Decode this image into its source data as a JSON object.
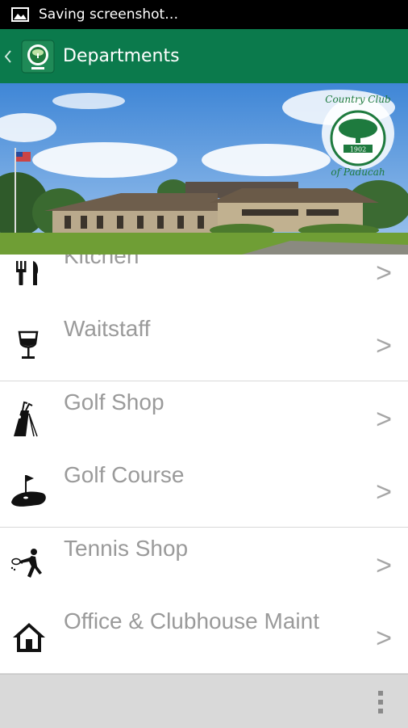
{
  "status_bar": {
    "text": "Saving screenshot…",
    "icon": "image-icon"
  },
  "action_bar": {
    "title": "Departments",
    "icons": [
      "up-caret-icon",
      "club-logo"
    ]
  },
  "hero": {
    "logo_line1": "Country Club",
    "logo_year": "1902",
    "logo_line2": "of Paducah"
  },
  "departments": [
    {
      "label": "Kitchen",
      "icon": "utensils-icon"
    },
    {
      "label": "Waitstaff",
      "icon": "wine-glass-icon"
    },
    {
      "label": "Golf Shop",
      "icon": "golf-bag-icon"
    },
    {
      "label": "Golf Course",
      "icon": "golf-flag-icon"
    },
    {
      "label": "Tennis Shop",
      "icon": "tennis-player-icon"
    },
    {
      "label": "Office & Clubhouse Maint",
      "icon": "house-icon"
    }
  ],
  "chevron": ">",
  "colors": {
    "brand_green": "#0b7a4c",
    "status_bar": "#000000",
    "bottom_bar": "#d9d9d9",
    "label_gray": "#9a9a9a"
  }
}
